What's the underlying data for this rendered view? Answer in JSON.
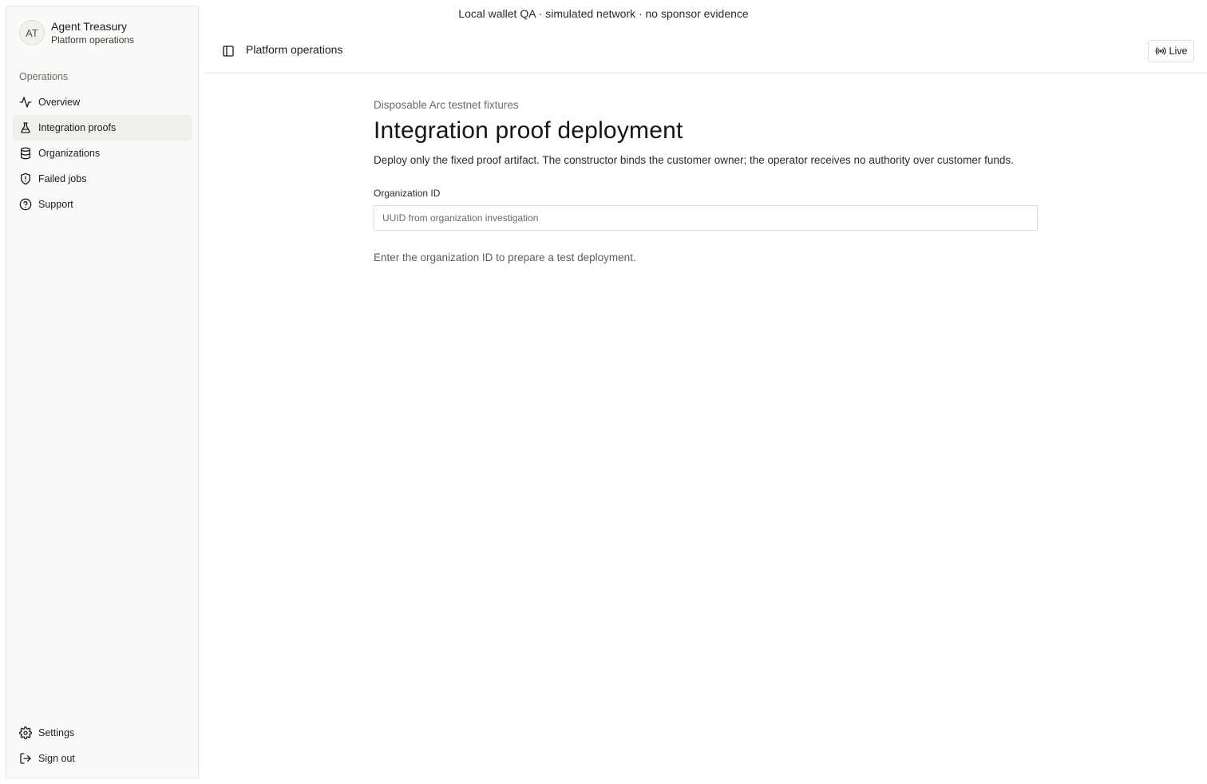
{
  "banner": "Local wallet QA · simulated network · no sponsor evidence",
  "brand": {
    "initials": "AT",
    "name": "Agent Treasury",
    "subtitle": "Platform operations"
  },
  "sidebar": {
    "section_label": "Operations",
    "items": [
      {
        "label": "Overview",
        "icon": "activity-icon"
      },
      {
        "label": "Integration proofs",
        "icon": "flask-icon",
        "active": true
      },
      {
        "label": "Organizations",
        "icon": "database-icon"
      },
      {
        "label": "Failed jobs",
        "icon": "shield-alert-icon"
      },
      {
        "label": "Support",
        "icon": "help-circle-icon"
      }
    ],
    "bottom_items": [
      {
        "label": "Settings",
        "icon": "gear-icon"
      },
      {
        "label": "Sign out",
        "icon": "sign-out-icon"
      }
    ]
  },
  "topbar": {
    "title": "Platform operations",
    "live_label": "Live"
  },
  "main": {
    "eyebrow": "Disposable Arc testnet fixtures",
    "title": "Integration proof deployment",
    "description": "Deploy only the fixed proof artifact. The constructor binds the customer owner; the operator receives no authority over customer funds.",
    "org_field": {
      "label": "Organization ID",
      "placeholder": "UUID from organization investigation",
      "value": ""
    },
    "hint": "Enter the organization ID to prepare a test deployment."
  }
}
